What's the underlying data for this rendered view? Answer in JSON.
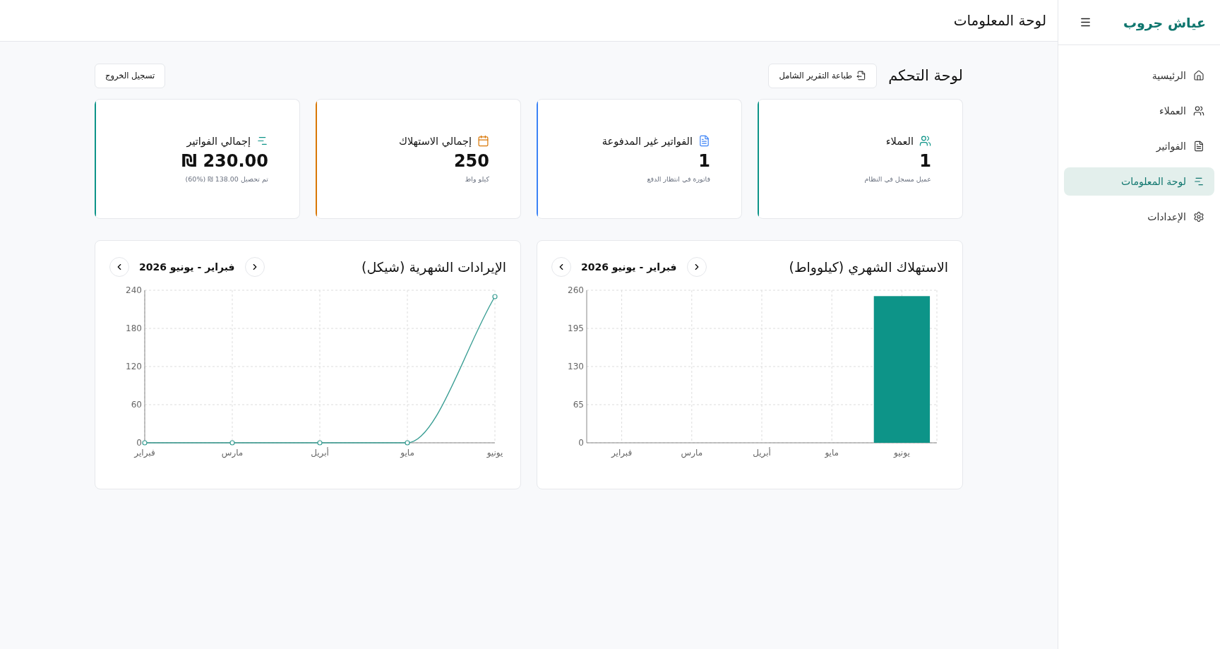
{
  "sidebar": {
    "brand": "عياش جروب",
    "items": [
      {
        "label": "الرئيسية",
        "selected": false
      },
      {
        "label": "العملاء",
        "selected": false
      },
      {
        "label": "الفواتير",
        "selected": false
      },
      {
        "label": "لوحة المعلومات",
        "selected": true
      },
      {
        "label": "الإعدادات",
        "selected": false
      }
    ]
  },
  "header": {
    "title": "لوحة المعلومات"
  },
  "page": {
    "title": "لوحة التحكم",
    "print_button": "طباعة التقرير الشامل",
    "logout_button": "تسجيل الخروج"
  },
  "stats": [
    {
      "title": "العملاء",
      "color": "#0d9488",
      "value": "1",
      "note": "عميل مسجل في النظام"
    },
    {
      "title": "الفواتير غير المدفوعة",
      "color": "#3b82f6",
      "value": "1",
      "note": "فاتورة في انتظار الدفع"
    },
    {
      "title": "إجمالي الاستهلاك",
      "color": "#d97706",
      "value": "250",
      "note": "كيلو واط"
    },
    {
      "title": "إجمالي الفواتير",
      "color": "#0d9488",
      "value": "230.00 ₪",
      "note": "تم تحصيل 138.00 ₪ (%60)"
    }
  ],
  "charts": [
    {
      "title": "الاستهلاك الشهري (كيلوواط)",
      "range": "فبراير - يونيو 2026",
      "chart_data": {
        "type": "bar",
        "categories": [
          "فبراير",
          "مارس",
          "أبريل",
          "مايو",
          "يونيو"
        ],
        "series": [
          {
            "color": "#0d9488",
            "values": [
              0,
              0,
              0,
              0,
              250
            ]
          }
        ],
        "ylim": [
          0,
          260
        ],
        "yticks": [
          0,
          65,
          130,
          195,
          260
        ],
        "grid": true
      }
    },
    {
      "title": "الإيرادات الشهرية (شيكل)",
      "range": "فبراير - يونيو 2026",
      "chart_data": {
        "type": "line",
        "categories": [
          "فبراير",
          "مارس",
          "أبريل",
          "مايو",
          "يونيو"
        ],
        "series": [
          {
            "color": "#3a9e94",
            "values": [
              0,
              0,
              0,
              0,
              230
            ],
            "marker": "circle"
          }
        ],
        "ylim": [
          0,
          240
        ],
        "yticks": [
          0,
          60,
          120,
          180,
          240
        ],
        "grid": true
      }
    }
  ]
}
